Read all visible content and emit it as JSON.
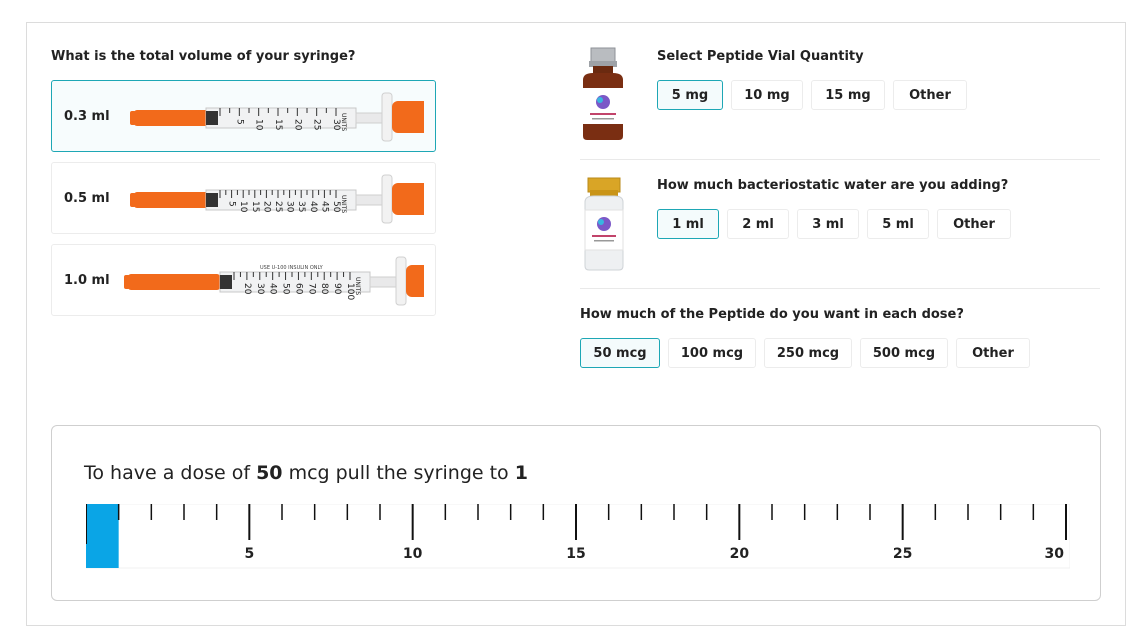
{
  "syringe_section": {
    "question": "What is the total volume of your syringe?",
    "options": [
      {
        "label": "0.3 ml",
        "marks": [
          "5",
          "10",
          "15",
          "20",
          "25",
          "30"
        ],
        "unit": "UNITS",
        "selected": true
      },
      {
        "label": "0.5 ml",
        "marks": [
          "5",
          "10",
          "15",
          "20",
          "25",
          "30",
          "35",
          "40",
          "45",
          "50"
        ],
        "unit": "UNITS",
        "selected": false
      },
      {
        "label": "1.0 ml",
        "marks": [
          "20",
          "30",
          "40",
          "50",
          "60",
          "70",
          "80",
          "90",
          "100"
        ],
        "unit": "UNITS",
        "caption": "USE U-100 INSULIN ONLY",
        "selected": false
      }
    ]
  },
  "vial_quantity": {
    "question": "Select Peptide Vial Quantity",
    "options": [
      "5 mg",
      "10 mg",
      "15 mg",
      "Other"
    ],
    "selected_index": 0
  },
  "water_amount": {
    "question": "How much bacteriostatic water are you adding?",
    "options": [
      "1 ml",
      "2 ml",
      "3 ml",
      "5 ml",
      "Other"
    ],
    "selected_index": 0
  },
  "dose_amount": {
    "question": "How much of the Peptide do you want in each dose?",
    "options": [
      "50 mcg",
      "100 mcg",
      "250 mcg",
      "500 mcg",
      "Other"
    ],
    "selected_index": 0
  },
  "result": {
    "prefix": "To have a dose of",
    "dose_value": "50",
    "middle": "mcg pull the syringe to",
    "units_value": "1",
    "scale": {
      "min": 0,
      "max": 30,
      "labels": [
        "5",
        "10",
        "15",
        "20",
        "25",
        "30"
      ],
      "fill_value": 1
    }
  },
  "colors": {
    "accent": "#1ea7b5",
    "fill": "#0aa5e6",
    "syringe_orange": "#f26a1b"
  }
}
